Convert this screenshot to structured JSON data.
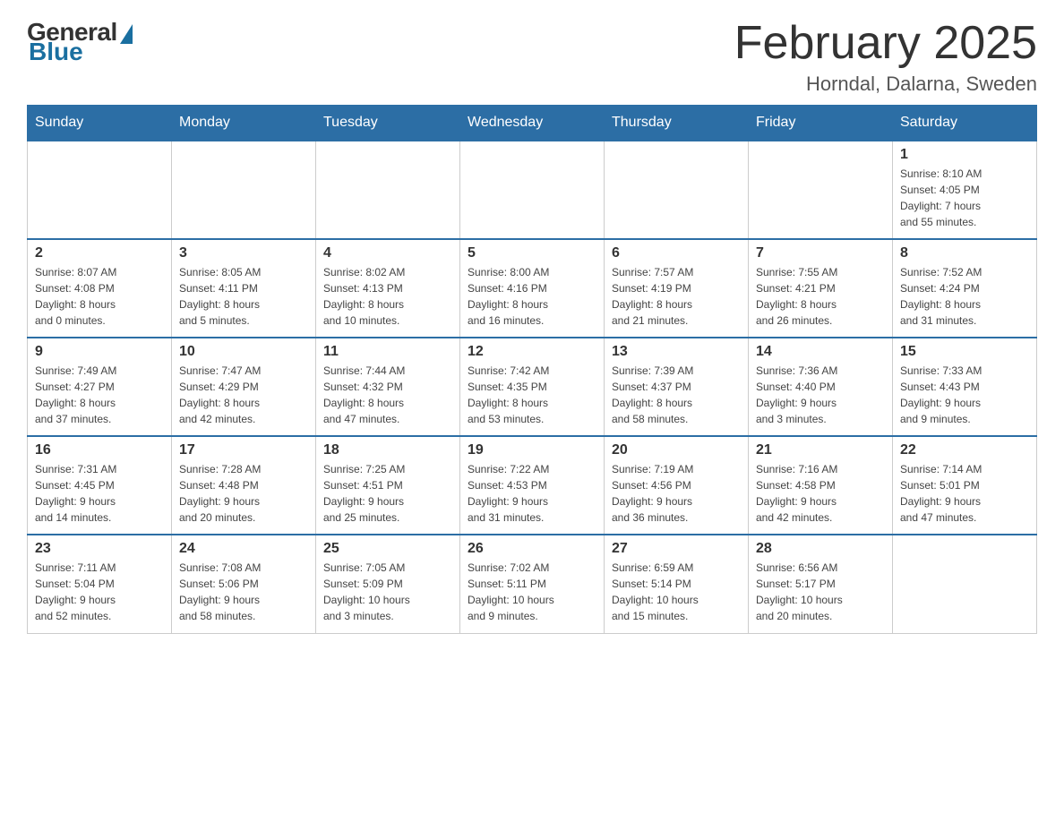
{
  "header": {
    "logo": {
      "general_text": "General",
      "blue_text": "Blue"
    },
    "title": "February 2025",
    "subtitle": "Horndal, Dalarna, Sweden"
  },
  "weekdays": [
    "Sunday",
    "Monday",
    "Tuesday",
    "Wednesday",
    "Thursday",
    "Friday",
    "Saturday"
  ],
  "weeks": [
    [
      {
        "day": "",
        "info": ""
      },
      {
        "day": "",
        "info": ""
      },
      {
        "day": "",
        "info": ""
      },
      {
        "day": "",
        "info": ""
      },
      {
        "day": "",
        "info": ""
      },
      {
        "day": "",
        "info": ""
      },
      {
        "day": "1",
        "info": "Sunrise: 8:10 AM\nSunset: 4:05 PM\nDaylight: 7 hours\nand 55 minutes."
      }
    ],
    [
      {
        "day": "2",
        "info": "Sunrise: 8:07 AM\nSunset: 4:08 PM\nDaylight: 8 hours\nand 0 minutes."
      },
      {
        "day": "3",
        "info": "Sunrise: 8:05 AM\nSunset: 4:11 PM\nDaylight: 8 hours\nand 5 minutes."
      },
      {
        "day": "4",
        "info": "Sunrise: 8:02 AM\nSunset: 4:13 PM\nDaylight: 8 hours\nand 10 minutes."
      },
      {
        "day": "5",
        "info": "Sunrise: 8:00 AM\nSunset: 4:16 PM\nDaylight: 8 hours\nand 16 minutes."
      },
      {
        "day": "6",
        "info": "Sunrise: 7:57 AM\nSunset: 4:19 PM\nDaylight: 8 hours\nand 21 minutes."
      },
      {
        "day": "7",
        "info": "Sunrise: 7:55 AM\nSunset: 4:21 PM\nDaylight: 8 hours\nand 26 minutes."
      },
      {
        "day": "8",
        "info": "Sunrise: 7:52 AM\nSunset: 4:24 PM\nDaylight: 8 hours\nand 31 minutes."
      }
    ],
    [
      {
        "day": "9",
        "info": "Sunrise: 7:49 AM\nSunset: 4:27 PM\nDaylight: 8 hours\nand 37 minutes."
      },
      {
        "day": "10",
        "info": "Sunrise: 7:47 AM\nSunset: 4:29 PM\nDaylight: 8 hours\nand 42 minutes."
      },
      {
        "day": "11",
        "info": "Sunrise: 7:44 AM\nSunset: 4:32 PM\nDaylight: 8 hours\nand 47 minutes."
      },
      {
        "day": "12",
        "info": "Sunrise: 7:42 AM\nSunset: 4:35 PM\nDaylight: 8 hours\nand 53 minutes."
      },
      {
        "day": "13",
        "info": "Sunrise: 7:39 AM\nSunset: 4:37 PM\nDaylight: 8 hours\nand 58 minutes."
      },
      {
        "day": "14",
        "info": "Sunrise: 7:36 AM\nSunset: 4:40 PM\nDaylight: 9 hours\nand 3 minutes."
      },
      {
        "day": "15",
        "info": "Sunrise: 7:33 AM\nSunset: 4:43 PM\nDaylight: 9 hours\nand 9 minutes."
      }
    ],
    [
      {
        "day": "16",
        "info": "Sunrise: 7:31 AM\nSunset: 4:45 PM\nDaylight: 9 hours\nand 14 minutes."
      },
      {
        "day": "17",
        "info": "Sunrise: 7:28 AM\nSunset: 4:48 PM\nDaylight: 9 hours\nand 20 minutes."
      },
      {
        "day": "18",
        "info": "Sunrise: 7:25 AM\nSunset: 4:51 PM\nDaylight: 9 hours\nand 25 minutes."
      },
      {
        "day": "19",
        "info": "Sunrise: 7:22 AM\nSunset: 4:53 PM\nDaylight: 9 hours\nand 31 minutes."
      },
      {
        "day": "20",
        "info": "Sunrise: 7:19 AM\nSunset: 4:56 PM\nDaylight: 9 hours\nand 36 minutes."
      },
      {
        "day": "21",
        "info": "Sunrise: 7:16 AM\nSunset: 4:58 PM\nDaylight: 9 hours\nand 42 minutes."
      },
      {
        "day": "22",
        "info": "Sunrise: 7:14 AM\nSunset: 5:01 PM\nDaylight: 9 hours\nand 47 minutes."
      }
    ],
    [
      {
        "day": "23",
        "info": "Sunrise: 7:11 AM\nSunset: 5:04 PM\nDaylight: 9 hours\nand 52 minutes."
      },
      {
        "day": "24",
        "info": "Sunrise: 7:08 AM\nSunset: 5:06 PM\nDaylight: 9 hours\nand 58 minutes."
      },
      {
        "day": "25",
        "info": "Sunrise: 7:05 AM\nSunset: 5:09 PM\nDaylight: 10 hours\nand 3 minutes."
      },
      {
        "day": "26",
        "info": "Sunrise: 7:02 AM\nSunset: 5:11 PM\nDaylight: 10 hours\nand 9 minutes."
      },
      {
        "day": "27",
        "info": "Sunrise: 6:59 AM\nSunset: 5:14 PM\nDaylight: 10 hours\nand 15 minutes."
      },
      {
        "day": "28",
        "info": "Sunrise: 6:56 AM\nSunset: 5:17 PM\nDaylight: 10 hours\nand 20 minutes."
      },
      {
        "day": "",
        "info": ""
      }
    ]
  ]
}
